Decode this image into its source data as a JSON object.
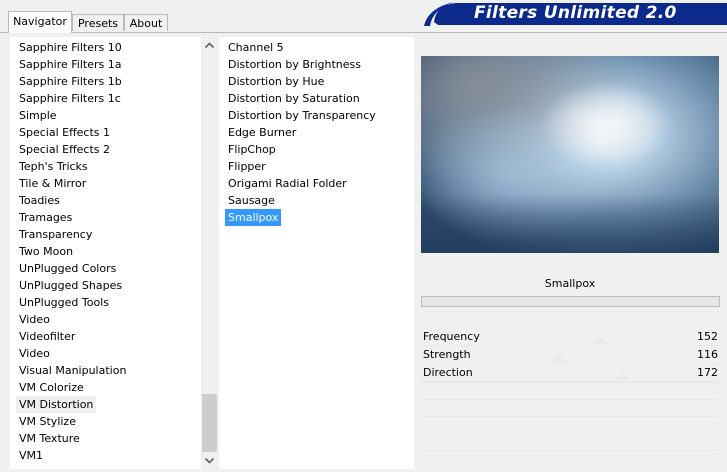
{
  "tabs": [
    {
      "label": "Navigator",
      "active": true
    },
    {
      "label": "Presets",
      "active": false
    },
    {
      "label": "About",
      "active": false
    }
  ],
  "banner": {
    "title": "Filters Unlimited 2.0",
    "color": "#0b2a8c"
  },
  "navigator": {
    "items": [
      "Sapphire Filters 10",
      "Sapphire Filters 1a",
      "Sapphire Filters 1b",
      "Sapphire Filters 1c",
      "Simple",
      "Special Effects 1",
      "Special Effects 2",
      "Teph's Tricks",
      "Tile & Mirror",
      "Toadies",
      "Tramages",
      "Transparency",
      "Two Moon",
      "UnPlugged Colors",
      "UnPlugged Shapes",
      "UnPlugged Tools",
      "Video",
      "Videofilter",
      "Video",
      "Visual Manipulation",
      "VM Colorize",
      "VM Distortion",
      "VM Stylize",
      "VM Texture",
      "VM1"
    ],
    "highlighted": "VM Distortion",
    "scroll_up_icon": "chevron-up-icon",
    "scroll_down_icon": "chevron-down-icon"
  },
  "filters": {
    "items": [
      "Channel 5",
      "Distortion by Brightness",
      "Distortion by Hue",
      "Distortion by Saturation",
      "Distortion by Transparency",
      "Edge Burner",
      "FlipChop",
      "Flipper",
      "Origami Radial Folder",
      "Sausage",
      "Smallpox"
    ],
    "selected": "Smallpox",
    "selected_color": "#3399ff"
  },
  "preview": {
    "filter_name": "Smallpox"
  },
  "params": [
    {
      "label": "Frequency",
      "value": "152"
    },
    {
      "label": "Strength",
      "value": "116"
    },
    {
      "label": "Direction",
      "value": "172"
    }
  ]
}
